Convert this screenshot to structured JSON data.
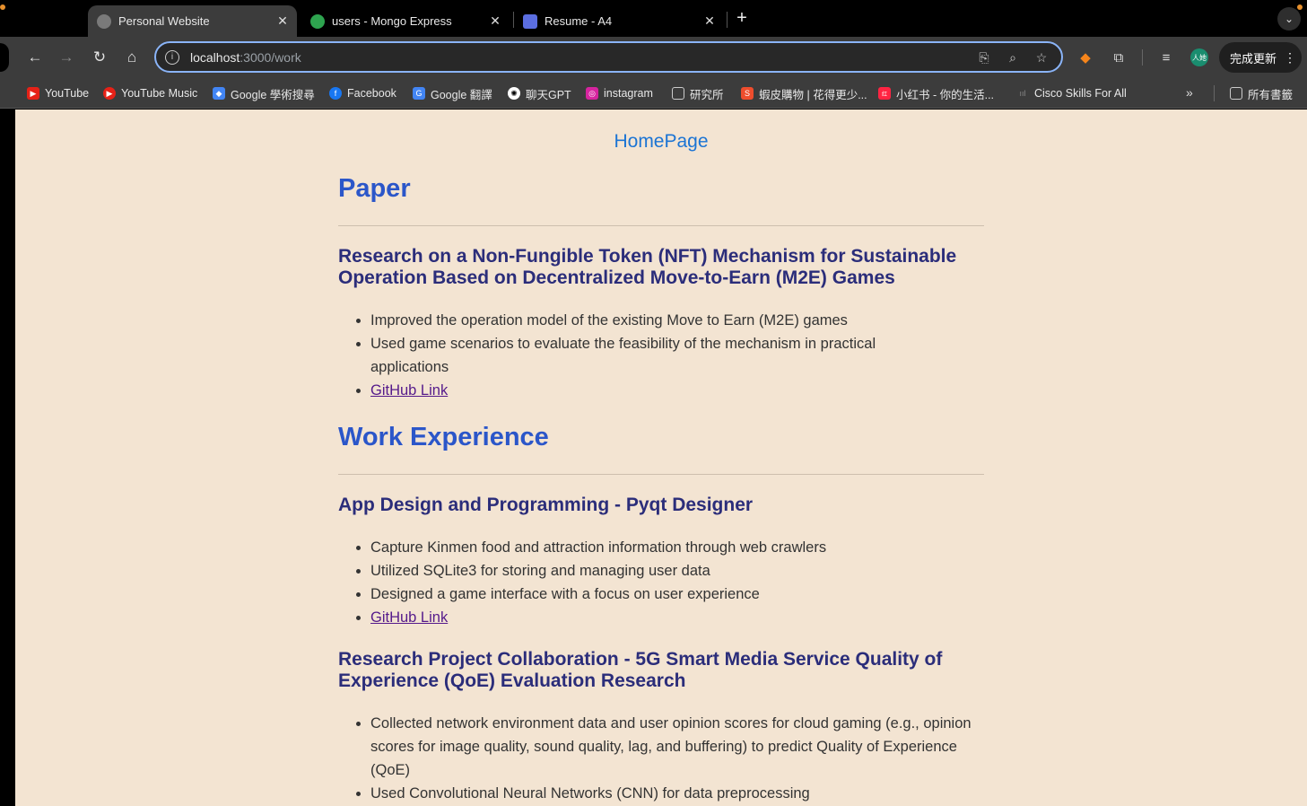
{
  "browser": {
    "tabs": [
      {
        "title": "Personal Website",
        "active": true
      },
      {
        "title": "users - Mongo Express",
        "active": false
      },
      {
        "title": "Resume - A4",
        "active": false
      }
    ],
    "url_host": "localhost",
    "url_path": ":3000/work",
    "update_label": "完成更新",
    "profile_label": "人她",
    "bookmarks": [
      {
        "label": "YouTube",
        "icon": "youtube-icon",
        "color": "#e62117"
      },
      {
        "label": "YouTube Music",
        "icon": "youtube-music-icon",
        "color": "#e62117"
      },
      {
        "label": "Google 學術搜尋",
        "icon": "scholar-icon",
        "color": "#4285f4"
      },
      {
        "label": "Facebook",
        "icon": "facebook-icon",
        "color": "#1877f2"
      },
      {
        "label": "Google 翻譯",
        "icon": "translate-icon",
        "color": "#4285f4"
      },
      {
        "label": "聊天GPT",
        "icon": "chatgpt-icon",
        "color": "#ffffff"
      },
      {
        "label": "instagram",
        "icon": "instagram-icon",
        "color": "#d6249f"
      },
      {
        "label": "研究所",
        "icon": "folder-icon",
        "color": "#cccccc"
      },
      {
        "label": "蝦皮購物 | 花得更少...",
        "icon": "shopee-icon",
        "color": "#ee4d2d"
      },
      {
        "label": "小红书 - 你的生活...",
        "icon": "xiaohongshu-icon",
        "color": "#ff2442"
      },
      {
        "label": "Cisco Skills For All",
        "icon": "cisco-icon",
        "color": "#888888"
      }
    ],
    "all_bookmarks_label": "所有書籤"
  },
  "page": {
    "home_link": "HomePage",
    "paper_heading": "Paper",
    "paper": {
      "title": "Research on a Non-Fungible Token (NFT) Mechanism for Sustainable Operation Based on Decentralized Move-to-Earn (M2E) Games",
      "bullets": [
        "Improved the operation model of the existing Move to Earn (M2E) games",
        "Used game scenarios to evaluate the feasibility of the mechanism in practical applications"
      ],
      "link": "GitHub Link"
    },
    "work_heading": "Work Experience",
    "job1": {
      "title": "App Design and Programming - Pyqt Designer",
      "bullets": [
        "Capture Kinmen food and attraction information through web crawlers",
        "Utilized SQLite3 for storing and managing user data",
        "Designed a game interface with a focus on user experience"
      ],
      "link": "GitHub Link"
    },
    "job2": {
      "title": "Research Project Collaboration - 5G Smart Media Service Quality of Experience (QoE) Evaluation Research",
      "bullets": [
        "Collected network environment data and user opinion scores for cloud gaming (e.g., opinion scores for image quality, sound quality, lag, and buffering) to predict Quality of Experience (QoE)",
        "Used Convolutional Neural Networks (CNN) for data preprocessing"
      ]
    }
  }
}
